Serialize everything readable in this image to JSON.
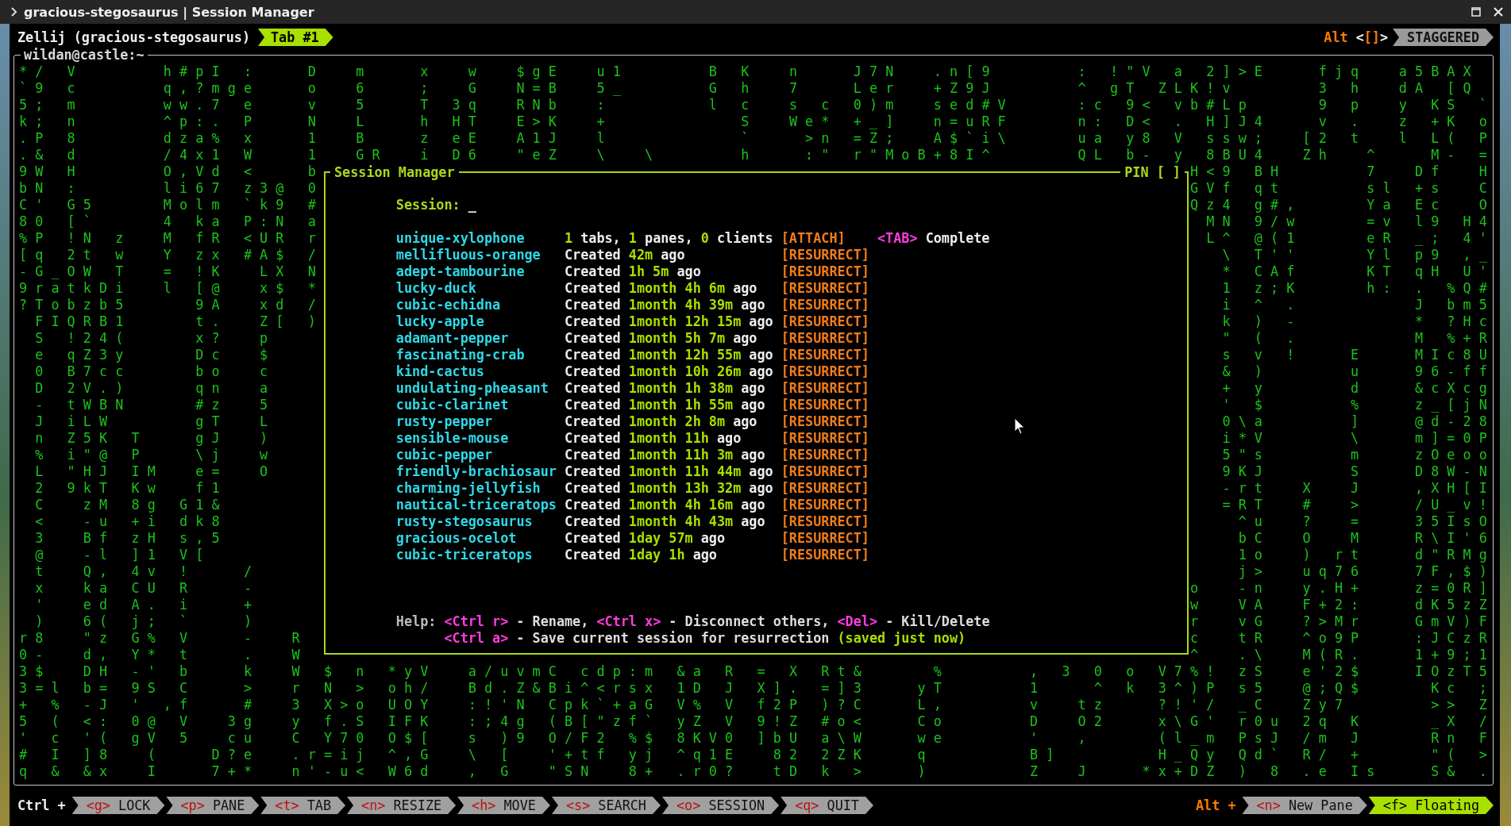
{
  "window": {
    "title": "gracious-stegosaurus | Session Manager"
  },
  "tab_bar": {
    "session": "Zellij (gracious-stegosaurus)",
    "tabs": [
      {
        "label": "Tab #1",
        "selected": true
      }
    ],
    "modifier": "Alt",
    "swap_key": "<**[]**>",
    "layout": "STAGGERED"
  },
  "pane": {
    "title": "wildan@castle:~",
    "lines": [
      {
        "left": "* /   V           h # p I   :       D     m       x     w     $ g E     u 1           B   K     n       J 7 N     . n [ 9           :   ! \" V   a",
        "right": "  2 ] > E       f j q     a 5 B A X"
      },
      {
        "left": "` 9   c           q , ? m g e       o     6       ;     G     N = B     5 _           G   h     7       L e r     + Z 9 J           ^   g T   Z L",
        "right": "K ! v           3   h     d A   [ Q"
      },
      {
        "left": "5 ;   m           w w . 7   e       v     5       T   3 q     R N b     :             l   c     s   c   0 ) m     s e d # V         : c   9 <   v",
        "right": "b # L p         9   p     y   K S   `"
      },
      {
        "left": "k ;   n           ^ p : .   P       N     L       h   H T     E > K     +                 S     W e *   + _ ]     n = u R F         n :   D <   .",
        "right": "  H ] J 4       v   .     z   + K   o"
      },
      {
        "left": ". P   8           d z a %   x       1     B       z   e E     A 1 J     l                 `       > n   = Z ;     A $ ` i \\         u a   y 8   V",
        "right": "  s s w ;     [ 2   t     l   L (   P"
      },
      {
        "left": ". &   d           / 4 x 1   W       1     G R     i   D 6     \" e Z     \\     \\           h       : \"   r \" M o B + 8 I ^           Q L   b -   y",
        "right": "  8 B U 4     Z h     ^       M -   ="
      },
      {
        "left": "9 W   H           O , V d   <       b",
        "right": "H < 9   B H           7     D f     H"
      },
      {
        "left": "b N   :           l i 6 7   z 3 @   0",
        "right": "G V f   q t           s l   + s     C"
      },
      {
        "left": "C '   G 5         M o l m   ` k 9   #",
        "right": "Q z 4   g # ,         Y a   E c     O"
      },
      {
        "left": "8 0   [ `         4   k a   P : N   a",
        "right": "  M N   9 / w         = v   l 9   H 4"
      },
      {
        "left": "% P   ! N   z     M   f R   < U R   r",
        "right": "  L ^   @ ( 1         e R   _ ;   4 '"
      },
      {
        "left": "[ q   2 t   w     Y   z x   # A $   /",
        "right": "    \\   T ' '         Y l   p 9   , _"
      },
      {
        "left": "- G _ O W   T     =   ! K     L X   N",
        "right": "    *   C A f         K T   q H   U '"
      },
      {
        "left": "9 r a t k D i     l   [ @     x $   *",
        "right": "    1   z ; K         h :   .   % Q #"
      },
      {
        "left": "? T o b z b 5         9 A     x d   /",
        "right": "    i   ^   .               J   b m 5"
      },
      {
        "left": "  F I Q R B 1         t .     Z [   )",
        "right": "    k   )   -               *   ? H c"
      },
      {
        "left": "  S   ! 2 4 (         x ?     p",
        "right": "    \"   (   .               M   % + R"
      },
      {
        "left": "  e   q Z 3 y         D c     $",
        "right": "    s   v   !       E       M I c 8 U"
      },
      {
        "left": "  0   B 7 c c         b o     c",
        "right": "    &   )           u       9 6 - f f"
      },
      {
        "left": "  D   2 V . )         q n     a",
        "right": "    +   y           d       & c X c g"
      },
      {
        "left": "  -   t W B N         # z     5",
        "right": "    '   $           %       z _ [ j N"
      },
      {
        "left": "  J   i L W           g T     L",
        "right": "    0 \\ a           ]       @ d - 2 8"
      },
      {
        "left": "  n   Z 5 K   T       g J     )",
        "right": "    i * V           \\       m ] = 0 P"
      },
      {
        "left": "  %   i \" @   P       \\ j     w",
        "right": "    5 \" s           m       z O e o o"
      },
      {
        "left": "  L   \" H J   I M     e =     O",
        "right": "    9 K J           S       D 8 W - N"
      },
      {
        "left": "  2   9 k T   K w     f 1",
        "right": "    - r t     X     J       , X H [ I"
      },
      {
        "left": "  C     z M   8 g   G 1 &",
        "right": "    = R T     #     >       / U _ v !"
      },
      {
        "left": "  <     - u   + i   d k 8",
        "right": "      ^ u     ?     =       3 5 I s O"
      },
      {
        "left": "  3     B f   z H   s , 5",
        "right": "      b C     O     M       R \\ I ' 6"
      },
      {
        "left": "  @     - l   ] 1   V [",
        "right": "      1 o     )   r t       d \" R M g"
      },
      {
        "left": "  t     Q ,   4 v   !       /",
        "right": "      j >     u q 7 6       7 F , $ )"
      },
      {
        "left": "  x     k a   C U   R       -",
        "right": "o     - n     y . H +       z = 0 R ]"
      },
      {
        "left": "  '     e d   A .   i       +",
        "right": "w     V A     F + 2 :       d K 5 z Z"
      },
      {
        "left": "  )     6 (   j ;   `       )",
        "right": "r     v G     ? > M r       G m V ) F"
      },
      {
        "left": "r 8     \" z   G %   V       -     R",
        "right": "c     t R     ^ o 9 P       : J C z R"
      },
      {
        "left": "0 -     d ,   Y *   t       .     W",
        "right": "^     . \\     M ( R .       1 + 9 ; 1"
      },
      {
        "left": "3 $     D H   - '   b       k     W   $   n   * y V     a / u v m C   c d p : m   & a   R   =   X   R t &         %           ,   3   0   o   V 7",
        "right": "% !   z S     e ' 2 $       I O z T 5"
      },
      {
        "left": "3 = l   b =   9 S   C       >     r   N   >   o h /     B d . Z & B i ^ < r s x   1 D   J   X ] .   = ] 3       y T           1       ^   k   3 ^",
        "right": ") P   s 5     @ ; Q $         K c   ;"
      },
      {
        "left": "+   %   - J   '   , f       #     3   X > o   U O Y     : ! ' N   C p k ` + a G   V %   V   f 2 P   ) ? C       L ,           v     t z       ? !",
        "right": "' /   _ C     Z y 7           > >   Z"
      },
      {
        "left": "5   (   < :   0 @   V     3 g     y   f . S   I F K     : ; 4 g   ( B [ \" z f `   y Z   V   9 ! Z   # o <       C o           D     O 2       x \\",
        "right": "G '   r 0 u   2 q   K         _ X   /"
      },
      {
        "left": "'   c   ' (   g V   5     c u     C   Y 7 0   O $ [     s   ) 9   O / F 2   % $   8 K V 0   ] b U   a \\ W       w e           '     ,         ( l",
        "right": "_ m   P s J   / m   J         R n   F"
      },
      {
        "left": "#   I   ] 8     (       D ? e     . r = i j   ^ , G     \\   [     ' + t f   y j   ^ q 1 E     8 2   2 Z K       q             B ]             H _",
        "right": "Q y   Q d `   R /   +         \" (   >"
      },
      {
        "left": "q   &   & x     I       7 + *     n ' - u <   W 6 d     ,   G     \" S N     8 +   . r 0 ?     t D   k   >       )             Z     J       * x +",
        "right": "D Z   )   8   . e   I s       S &   ."
      }
    ]
  },
  "session_manager": {
    "title": "Session Manager",
    "pin": "PIN [ ]",
    "prompt": {
      "label": "Session:",
      "cursor": "_"
    },
    "sessions": [
      {
        "name": "unique-xylophone",
        "info": "**1** tabs, **1** panes, **0** clients",
        "action": "[ATTACH]",
        "hint_key": "<TAB>",
        "hint": "Complete"
      },
      {
        "name": "mellifluous-orange",
        "info": "Created **42m** ago",
        "action": "[RESURRECT]"
      },
      {
        "name": "adept-tambourine",
        "info": "Created **1h 5m** ago",
        "action": "[RESURRECT]"
      },
      {
        "name": "lucky-duck",
        "info": "Created **1month 4h 6m** ago",
        "action": "[RESURRECT]"
      },
      {
        "name": "cubic-echidna",
        "info": "Created **1month 4h 39m** ago",
        "action": "[RESURRECT]"
      },
      {
        "name": "lucky-apple",
        "info": "Created **1month 12h 15m** ago",
        "action": "[RESURRECT]"
      },
      {
        "name": "adamant-pepper",
        "info": "Created **1month 5h 7m** ago",
        "action": "[RESURRECT]"
      },
      {
        "name": "fascinating-crab",
        "info": "Created **1month 12h 55m** ago",
        "action": "[RESURRECT]"
      },
      {
        "name": "kind-cactus",
        "info": "Created **1month 10h 26m** ago",
        "action": "[RESURRECT]"
      },
      {
        "name": "undulating-pheasant",
        "info": "Created **1month 1h 38m** ago",
        "action": "[RESURRECT]"
      },
      {
        "name": "cubic-clarinet",
        "info": "Created **1month 1h 55m** ago",
        "action": "[RESURRECT]"
      },
      {
        "name": "rusty-pepper",
        "info": "Created **1month 2h 8m** ago",
        "action": "[RESURRECT]"
      },
      {
        "name": "sensible-mouse",
        "info": "Created **1month 11h** ago",
        "action": "[RESURRECT]"
      },
      {
        "name": "cubic-pepper",
        "info": "Created **1month 11h 3m** ago",
        "action": "[RESURRECT]"
      },
      {
        "name": "friendly-brachiosaur",
        "info": "Created **1month 11h 44m** ago",
        "action": "[RESURRECT]"
      },
      {
        "name": "charming-jellyfish",
        "info": "Created **1month 13h 32m** ago",
        "action": "[RESURRECT]"
      },
      {
        "name": "nautical-triceratops",
        "info": "Created **1month 4h 16m** ago",
        "action": "[RESURRECT]"
      },
      {
        "name": "rusty-stegosaurus",
        "info": "Created **1month 4h 43m** ago",
        "action": "[RESURRECT]"
      },
      {
        "name": "gracious-ocelot",
        "info": "Created **1day 57m** ago",
        "action": "[RESURRECT]"
      },
      {
        "name": "cubic-triceratops",
        "info": "Created **1day 1h** ago",
        "action": "[RESURRECT]"
      }
    ],
    "help": {
      "label": "Help:",
      "lines": [
        [
          {
            "kind": "key",
            "text": "<Ctrl r>"
          },
          {
            "kind": "text",
            "text": " - Rename, "
          },
          {
            "kind": "key",
            "text": "<Ctrl x>"
          },
          {
            "kind": "text",
            "text": " - Disconnect others, "
          },
          {
            "kind": "key",
            "text": "<Del>"
          },
          {
            "kind": "text",
            "text": " - Kill/Delete"
          }
        ],
        [
          {
            "kind": "key",
            "text": "<Ctrl a>"
          },
          {
            "kind": "text",
            "text": " - Save current session for resurrection "
          },
          {
            "kind": "note",
            "text": "(saved just now)"
          }
        ]
      ]
    }
  },
  "status_bar": {
    "modifier": "Ctrl +",
    "items": [
      {
        "key": "<g>",
        "label": "LOCK",
        "selected": false
      },
      {
        "key": "<p>",
        "label": "PANE",
        "selected": false
      },
      {
        "key": "<t>",
        "label": "TAB",
        "selected": false
      },
      {
        "key": "<n>",
        "label": "RESIZE",
        "selected": false
      },
      {
        "key": "<h>",
        "label": "MOVE",
        "selected": false
      },
      {
        "key": "<s>",
        "label": "SEARCH",
        "selected": false
      },
      {
        "key": "<o>",
        "label": "SESSION",
        "selected": false
      },
      {
        "key": "<q>",
        "label": "QUIT",
        "selected": false
      }
    ],
    "right_modifier": "Alt +",
    "right_items": [
      {
        "key": "<n>",
        "label": "New Pane",
        "selected": false
      },
      {
        "key": "<f>",
        "label": "Floating",
        "selected": true
      }
    ]
  }
}
